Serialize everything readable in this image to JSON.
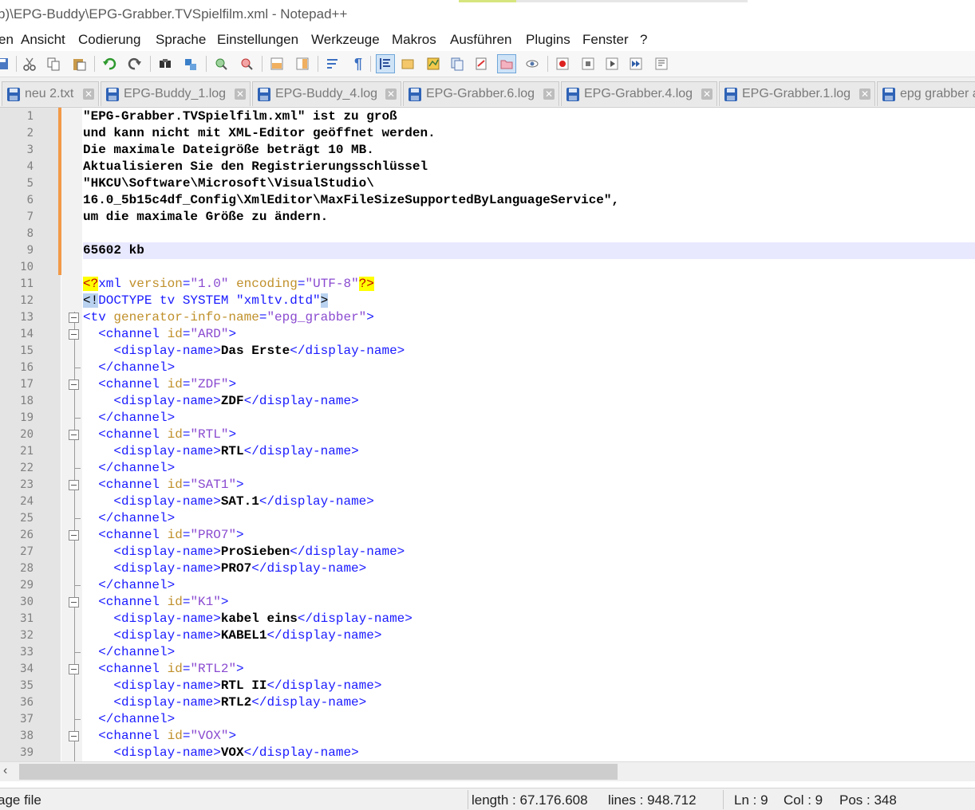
{
  "window": {
    "title": "b)\\EPG-Buddy\\EPG-Grabber.TVSpielfilm.xml - Notepad++"
  },
  "menu": [
    "en",
    "Ansicht",
    "Codierung",
    "Sprache",
    "Einstellungen",
    "Werkzeuge",
    "Makros",
    "Ausführen",
    "Plugins",
    "Fenster",
    "?"
  ],
  "toolbar_icons": [
    "save-all-icon",
    "cut-icon",
    "copy-icon",
    "paste-icon",
    "undo-icon",
    "redo-icon",
    "find-icon",
    "replace-icon",
    "zoom-in-icon",
    "zoom-out-icon",
    "sync-vertical-icon",
    "sync-horizontal-icon",
    "word-wrap-icon",
    "show-all-chars-icon",
    "indent-guide-icon",
    "udl-icon",
    "document-map-icon",
    "function-list-icon",
    "doc-list-icon",
    "folder-as-workspace-icon",
    "monitoring-icon",
    "record-macro-icon",
    "stop-record-icon",
    "play-macro-icon",
    "run-macro-multiple-icon",
    "save-macro-icon"
  ],
  "tabs": [
    {
      "label": "neu 2.txt"
    },
    {
      "label": "EPG-Buddy_1.log"
    },
    {
      "label": "EPG-Buddy_4.log"
    },
    {
      "label": "EPG-Grabber.6.log"
    },
    {
      "label": "EPG-Grabber.4.log"
    },
    {
      "label": "EPG-Grabber.1.log"
    },
    {
      "label": "epg grabber a"
    }
  ],
  "editor": {
    "current_line": 9,
    "lines": [
      {
        "n": "1",
        "segments": [
          [
            "bold",
            "\"EPG-Grabber.TVSpielfilm.xml\" ist zu groß"
          ]
        ]
      },
      {
        "n": "2",
        "segments": [
          [
            "bold",
            "und kann nicht mit XML-Editor geöffnet werden."
          ]
        ]
      },
      {
        "n": "3",
        "segments": [
          [
            "bold",
            "Die maximale Dateigröße beträgt 10 MB."
          ]
        ]
      },
      {
        "n": "4",
        "segments": [
          [
            "bold",
            "Aktualisieren Sie den Registrierungsschlüssel"
          ]
        ]
      },
      {
        "n": "5",
        "segments": [
          [
            "bold",
            "\"HKCU\\Software\\Microsoft\\VisualStudio\\"
          ]
        ]
      },
      {
        "n": "6",
        "segments": [
          [
            "bold",
            "16.0_5b15c4df_Config\\XmlEditor\\MaxFileSizeSupportedByLanguageService\","
          ]
        ]
      },
      {
        "n": "7",
        "segments": [
          [
            "bold",
            "um die maximale Größe zu ändern."
          ]
        ]
      },
      {
        "n": "8",
        "segments": []
      },
      {
        "n": "9",
        "segments": [
          [
            "bold",
            "65602 kb"
          ]
        ]
      },
      {
        "n": "10",
        "segments": []
      },
      {
        "n": "11",
        "segments": [
          [
            "pi",
            "<?"
          ],
          [
            "tag",
            "xml "
          ],
          [
            "attr",
            "version"
          ],
          [
            "tag",
            "="
          ],
          [
            "val",
            "\"1.0\""
          ],
          [
            "tag",
            " "
          ],
          [
            "attr",
            "encoding"
          ],
          [
            "tag",
            "="
          ],
          [
            "val",
            "\"UTF-8\""
          ],
          [
            "pi",
            "?>"
          ]
        ]
      },
      {
        "n": "12",
        "segments": [
          [
            "doct",
            "<!"
          ],
          [
            "tag",
            "DOCTYPE tv SYSTEM \"xmltv.dtd\""
          ],
          [
            "doct",
            ">"
          ]
        ]
      },
      {
        "n": "13",
        "segments": [
          [
            "tag",
            "<tv "
          ],
          [
            "attr",
            "generator-info-name"
          ],
          [
            "tag",
            "="
          ],
          [
            "val",
            "\"epg_grabber\""
          ],
          [
            "tag",
            ">"
          ]
        ]
      },
      {
        "n": "14",
        "segments": [
          [
            "tag",
            "  <channel "
          ],
          [
            "attr",
            "id"
          ],
          [
            "tag",
            "="
          ],
          [
            "val",
            "\"ARD\""
          ],
          [
            "tag",
            ">"
          ]
        ]
      },
      {
        "n": "15",
        "segments": [
          [
            "tag",
            "    <display-name>"
          ],
          [
            "bold",
            "Das Erste"
          ],
          [
            "tag",
            "</display-name>"
          ]
        ]
      },
      {
        "n": "16",
        "segments": [
          [
            "tag",
            "  </channel>"
          ]
        ]
      },
      {
        "n": "17",
        "segments": [
          [
            "tag",
            "  <channel "
          ],
          [
            "attr",
            "id"
          ],
          [
            "tag",
            "="
          ],
          [
            "val",
            "\"ZDF\""
          ],
          [
            "tag",
            ">"
          ]
        ]
      },
      {
        "n": "18",
        "segments": [
          [
            "tag",
            "    <display-name>"
          ],
          [
            "bold",
            "ZDF"
          ],
          [
            "tag",
            "</display-name>"
          ]
        ]
      },
      {
        "n": "19",
        "segments": [
          [
            "tag",
            "  </channel>"
          ]
        ]
      },
      {
        "n": "20",
        "segments": [
          [
            "tag",
            "  <channel "
          ],
          [
            "attr",
            "id"
          ],
          [
            "tag",
            "="
          ],
          [
            "val",
            "\"RTL\""
          ],
          [
            "tag",
            ">"
          ]
        ]
      },
      {
        "n": "21",
        "segments": [
          [
            "tag",
            "    <display-name>"
          ],
          [
            "bold",
            "RTL"
          ],
          [
            "tag",
            "</display-name>"
          ]
        ]
      },
      {
        "n": "22",
        "segments": [
          [
            "tag",
            "  </channel>"
          ]
        ]
      },
      {
        "n": "23",
        "segments": [
          [
            "tag",
            "  <channel "
          ],
          [
            "attr",
            "id"
          ],
          [
            "tag",
            "="
          ],
          [
            "val",
            "\"SAT1\""
          ],
          [
            "tag",
            ">"
          ]
        ]
      },
      {
        "n": "24",
        "segments": [
          [
            "tag",
            "    <display-name>"
          ],
          [
            "bold",
            "SAT.1"
          ],
          [
            "tag",
            "</display-name>"
          ]
        ]
      },
      {
        "n": "25",
        "segments": [
          [
            "tag",
            "  </channel>"
          ]
        ]
      },
      {
        "n": "26",
        "segments": [
          [
            "tag",
            "  <channel "
          ],
          [
            "attr",
            "id"
          ],
          [
            "tag",
            "="
          ],
          [
            "val",
            "\"PRO7\""
          ],
          [
            "tag",
            ">"
          ]
        ]
      },
      {
        "n": "27",
        "segments": [
          [
            "tag",
            "    <display-name>"
          ],
          [
            "bold",
            "ProSieben"
          ],
          [
            "tag",
            "</display-name>"
          ]
        ]
      },
      {
        "n": "28",
        "segments": [
          [
            "tag",
            "    <display-name>"
          ],
          [
            "bold",
            "PRO7"
          ],
          [
            "tag",
            "</display-name>"
          ]
        ]
      },
      {
        "n": "29",
        "segments": [
          [
            "tag",
            "  </channel>"
          ]
        ]
      },
      {
        "n": "30",
        "segments": [
          [
            "tag",
            "  <channel "
          ],
          [
            "attr",
            "id"
          ],
          [
            "tag",
            "="
          ],
          [
            "val",
            "\"K1\""
          ],
          [
            "tag",
            ">"
          ]
        ]
      },
      {
        "n": "31",
        "segments": [
          [
            "tag",
            "    <display-name>"
          ],
          [
            "bold",
            "kabel eins"
          ],
          [
            "tag",
            "</display-name>"
          ]
        ]
      },
      {
        "n": "32",
        "segments": [
          [
            "tag",
            "    <display-name>"
          ],
          [
            "bold",
            "KABEL1"
          ],
          [
            "tag",
            "</display-name>"
          ]
        ]
      },
      {
        "n": "33",
        "segments": [
          [
            "tag",
            "  </channel>"
          ]
        ]
      },
      {
        "n": "34",
        "segments": [
          [
            "tag",
            "  <channel "
          ],
          [
            "attr",
            "id"
          ],
          [
            "tag",
            "="
          ],
          [
            "val",
            "\"RTL2\""
          ],
          [
            "tag",
            ">"
          ]
        ]
      },
      {
        "n": "35",
        "segments": [
          [
            "tag",
            "    <display-name>"
          ],
          [
            "bold",
            "RTL II"
          ],
          [
            "tag",
            "</display-name>"
          ]
        ]
      },
      {
        "n": "36",
        "segments": [
          [
            "tag",
            "    <display-name>"
          ],
          [
            "bold",
            "RTL2"
          ],
          [
            "tag",
            "</display-name>"
          ]
        ]
      },
      {
        "n": "37",
        "segments": [
          [
            "tag",
            "  </channel>"
          ]
        ]
      },
      {
        "n": "38",
        "segments": [
          [
            "tag",
            "  <channel "
          ],
          [
            "attr",
            "id"
          ],
          [
            "tag",
            "="
          ],
          [
            "val",
            "\"VOX\""
          ],
          [
            "tag",
            ">"
          ]
        ]
      },
      {
        "n": "39",
        "segments": [
          [
            "tag",
            "    <display-name>"
          ],
          [
            "bold",
            "VOX"
          ],
          [
            "tag",
            "</display-name>"
          ]
        ]
      }
    ],
    "fold_lines": [
      13,
      14,
      17,
      20,
      23,
      26,
      30,
      34,
      38
    ]
  },
  "status": {
    "lang": "age file",
    "length": "length : 67.176.608",
    "lines": "lines : 948.712",
    "ln": "Ln : 9",
    "col": "Col : 9",
    "pos": "Pos : 348"
  },
  "colors": {
    "modified_marker": "#f29a48",
    "current_line_bg": "#e8e8ff",
    "tag": "#1a1aff",
    "attribute": "#c0902b",
    "value": "#8a4ad0"
  }
}
